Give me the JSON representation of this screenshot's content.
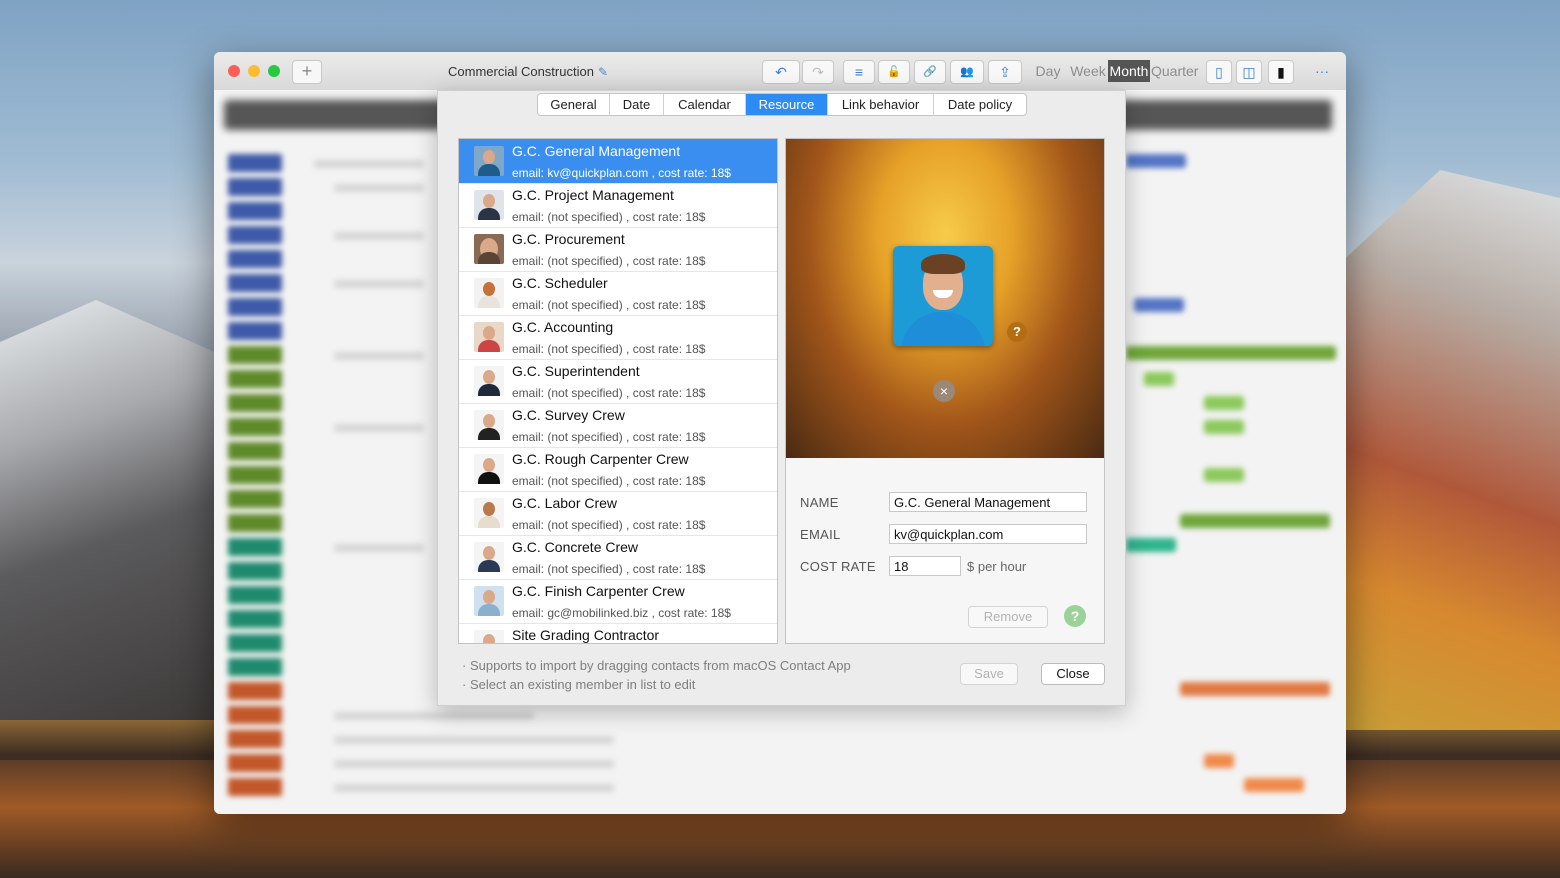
{
  "window": {
    "title": "Commercial Construction",
    "add_label": "+"
  },
  "toolbar": {
    "undo_icon": "↶",
    "redo_icon": "↷",
    "outline_icon": "≡",
    "lock_icon": "🔓",
    "link_icon": "🔗",
    "people_icon": "👥",
    "share_icon": "⇪",
    "views": [
      "Day",
      "Week",
      "Month",
      "Quarter"
    ],
    "selected_view": "Month",
    "more_label": "···"
  },
  "tabs": [
    "General",
    "Date",
    "Calendar",
    "Resource",
    "Link behavior",
    "Date policy"
  ],
  "active_tab": "Resource",
  "resources": [
    {
      "name": "G.C. General Management",
      "sub": "email: kv@quickplan.com , cost rate: 18$"
    },
    {
      "name": "G.C. Project Management",
      "sub": "email: (not specified) , cost rate: 18$"
    },
    {
      "name": "G.C. Procurement",
      "sub": "email: (not specified) , cost rate: 18$"
    },
    {
      "name": "G.C. Scheduler",
      "sub": "email: (not specified) , cost rate: 18$"
    },
    {
      "name": "G.C. Accounting",
      "sub": "email: (not specified) , cost rate: 18$"
    },
    {
      "name": "G.C. Superintendent",
      "sub": "email: (not specified) , cost rate: 18$"
    },
    {
      "name": "G.C. Survey Crew",
      "sub": "email: (not specified) , cost rate: 18$"
    },
    {
      "name": "G.C. Rough Carpenter Crew",
      "sub": "email: (not specified) , cost rate: 18$"
    },
    {
      "name": "G.C. Labor Crew",
      "sub": "email: (not specified) , cost rate: 18$"
    },
    {
      "name": "G.C. Concrete Crew",
      "sub": "email: (not specified) , cost rate: 18$"
    },
    {
      "name": "G.C. Finish Carpenter Crew",
      "sub": "email: gc@mobilinked.biz , cost rate: 18$"
    },
    {
      "name": "Site Grading Contractor",
      "sub": ""
    }
  ],
  "detail": {
    "help_badge": "?",
    "remove_photo_icon": "×",
    "name_label": "NAME",
    "name_value": "G.C. General Management",
    "email_label": "EMAIL",
    "email_value": "kv@quickplan.com",
    "cost_label": "COST RATE",
    "cost_value": "18",
    "cost_unit": "$ per hour",
    "remove_label": "Remove",
    "help_label": "?"
  },
  "footer": {
    "hint1": "· Supports to import by dragging contacts from macOS Contact App",
    "hint2": "· Select an existing member in list to edit",
    "save_label": "Save",
    "close_label": "Close"
  },
  "colors": {
    "accent": "#2d8cf4",
    "selected_row": "#3a8ef0"
  }
}
